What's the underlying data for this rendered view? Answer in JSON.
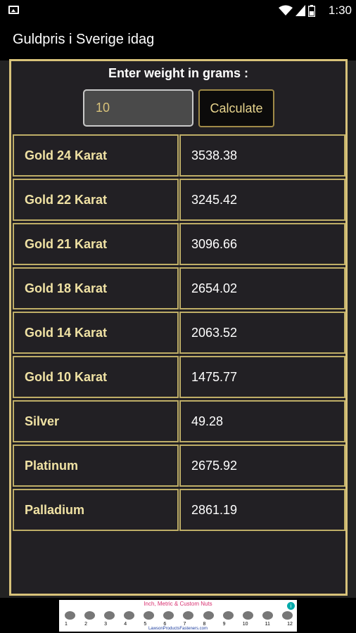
{
  "status_bar": {
    "time": "1:30",
    "icons": [
      "gallery-icon",
      "wifi-icon",
      "signal-icon",
      "battery-icon"
    ]
  },
  "app": {
    "title": "Guldpris i Sverige idag"
  },
  "form": {
    "weight_label": "Enter weight in grams :",
    "weight_value": "10",
    "calculate_label": "Calculate"
  },
  "prices": [
    {
      "name": "Gold 24 Karat",
      "value": "3538.38"
    },
    {
      "name": "Gold 22 Karat",
      "value": "3245.42"
    },
    {
      "name": "Gold 21 Karat",
      "value": "3096.66"
    },
    {
      "name": "Gold 18 Karat",
      "value": "2654.02"
    },
    {
      "name": "Gold 14 Karat",
      "value": "2063.52"
    },
    {
      "name": "Gold 10 Karat",
      "value": "1475.77"
    },
    {
      "name": "Silver",
      "value": "49.28"
    },
    {
      "name": "Platinum",
      "value": "2675.92"
    },
    {
      "name": "Palladium",
      "value": "2861.19"
    }
  ],
  "ad": {
    "headline": "Inch, Metric & Custom Nuts",
    "numbers": [
      "1",
      "2",
      "3",
      "4",
      "5",
      "6",
      "7",
      "8",
      "9",
      "10",
      "11",
      "12"
    ],
    "footer": "LawsonProductsFasteners.com"
  },
  "colors": {
    "accent_gold": "#d8c27a",
    "background": "#232323",
    "table_bg": "#222024",
    "bar_bg": "#000000"
  }
}
